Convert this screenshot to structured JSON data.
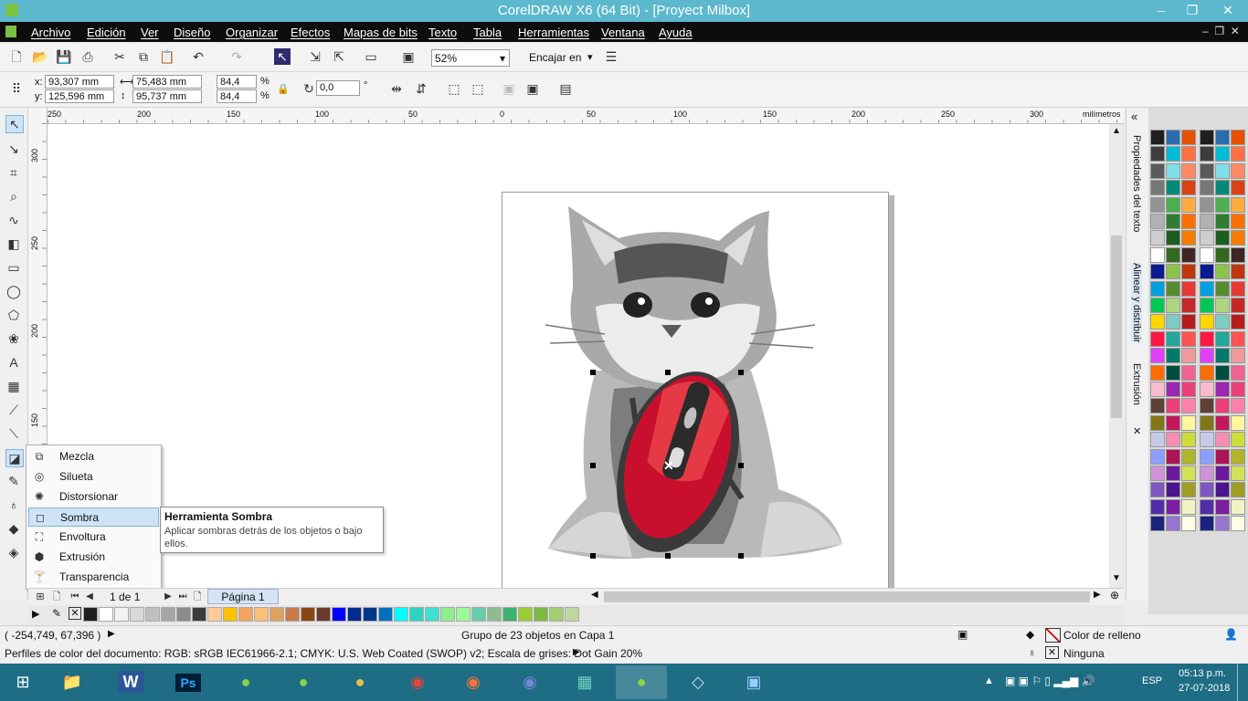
{
  "window": {
    "title": "CorelDRAW X6 (64 Bit) - [Proyect Milbox]",
    "minimize": "–",
    "restore": "❐",
    "close": "✕"
  },
  "menu": [
    "Archivo",
    "Edición",
    "Ver",
    "Diseño",
    "Organizar",
    "Efectos",
    "Mapas de bits",
    "Texto",
    "Tabla",
    "Herramientas",
    "Ventana",
    "Ayuda"
  ],
  "toolbar": {
    "zoom": "52%",
    "snap": "Encajar en"
  },
  "propbar": {
    "x_label": "x:",
    "y_label": "y:",
    "x": "93,307 mm",
    "y": "125,596 mm",
    "width": "75,483 mm",
    "height": "95,737 mm",
    "scale_x": "84,4",
    "scale_y": "84,4",
    "percent": "%",
    "angle": "0,0",
    "degree": "°"
  },
  "ruler": {
    "units": "milímetros",
    "h_ticks": [
      "250",
      "200",
      "150",
      "100",
      "50",
      "0",
      "50",
      "100",
      "150",
      "200",
      "250",
      "300"
    ],
    "v_ticks": [
      "300",
      "250",
      "200",
      "150"
    ]
  },
  "flyout": {
    "items": [
      {
        "label": "Mezcla",
        "icon": "blend-icon"
      },
      {
        "label": "Silueta",
        "icon": "contour-icon"
      },
      {
        "label": "Distorsionar",
        "icon": "distort-icon"
      },
      {
        "label": "Sombra",
        "icon": "shadow-icon",
        "selected": true
      },
      {
        "label": "Envoltura",
        "icon": "envelope-icon"
      },
      {
        "label": "Extrusión",
        "icon": "extrude-icon"
      },
      {
        "label": "Transparencia",
        "icon": "transparency-icon"
      }
    ]
  },
  "tooltip": {
    "title": "Herramienta Sombra",
    "body": "Aplicar sombras detrás de los objetos o bajo ellos."
  },
  "dockers": {
    "tab1": "Propiedades del texto",
    "tab2": "Alinear y distribuir",
    "tab3": "Extrusión"
  },
  "pagebar": {
    "counter": "1 de 1",
    "page_tab": "Página 1"
  },
  "status": {
    "coords": "( -254,749, 67,396 )",
    "selection": "Grupo de 23 objetos en Capa 1",
    "fill_label": "Color de relleno",
    "outline_label": "Ninguna",
    "color_profile": "Perfiles de color del documento: RGB: sRGB IEC61966-2.1; CMYK: U.S. Web Coated (SWOP) v2; Escala de grises: Dot Gain 20%"
  },
  "taskbar": {
    "lang": "ESP",
    "time": "05:13 p.m.",
    "date": "27-07-2018"
  },
  "colors": {
    "titlebar": "#5bb8cd",
    "taskbar": "#1e6d84",
    "accent_selected": "#cfe3f7"
  }
}
